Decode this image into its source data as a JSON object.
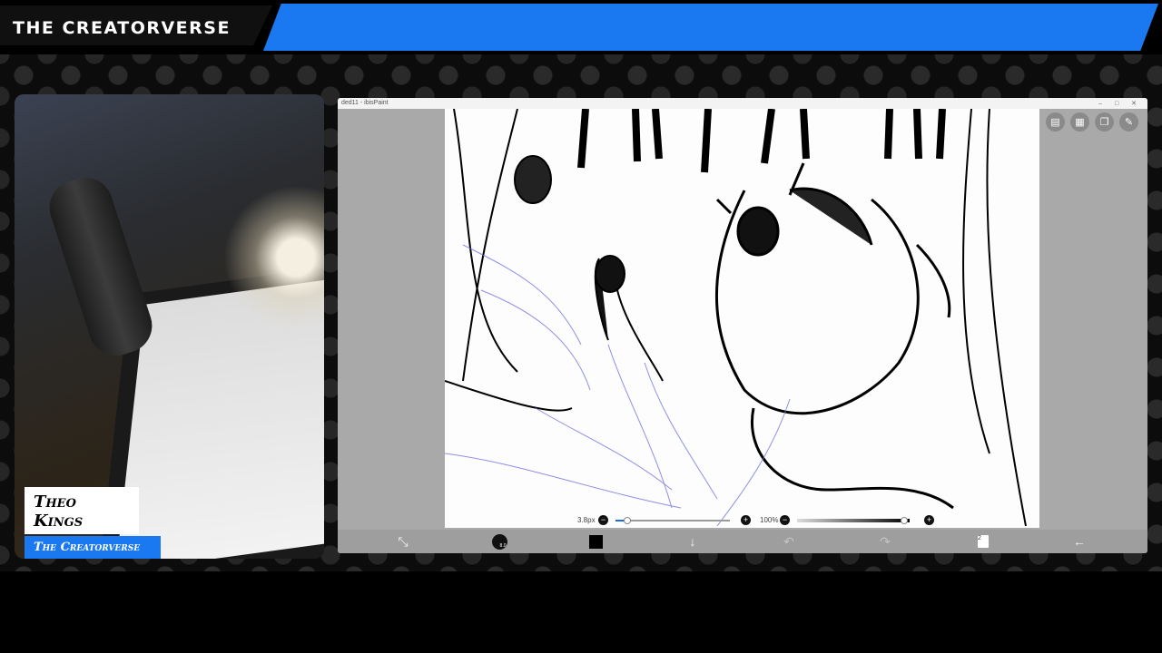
{
  "header": {
    "brand": "THE CREATORVERSE",
    "accent_color": "#1a78f0"
  },
  "webcam": {
    "name": "Theo Kings",
    "subtitle": "The Creatorverse"
  },
  "app": {
    "window_title": "ded11 - ibisPaint",
    "window_controls": [
      "–",
      "□",
      "✕"
    ],
    "right_tools": [
      {
        "icon": "layers-panel-icon",
        "glyph": "▤"
      },
      {
        "icon": "selection-icon",
        "glyph": "▦"
      },
      {
        "icon": "copy-icon",
        "glyph": "❐"
      },
      {
        "icon": "pen-icon",
        "glyph": "✎"
      }
    ],
    "brush_size": {
      "label": "3.8px",
      "value_fraction": 0.04
    },
    "zoom": {
      "label": "100%",
      "opacity_fraction": 0.98
    },
    "toolbar": {
      "transform_icon": "transform-icon",
      "brush_size_label": "8.0",
      "color_value": "#000000",
      "download_icon": "download-arrow-icon",
      "undo_icon": "undo-icon",
      "redo_icon": "redo-icon",
      "layer_count": "2",
      "back_icon": "back-arrow-icon"
    }
  }
}
